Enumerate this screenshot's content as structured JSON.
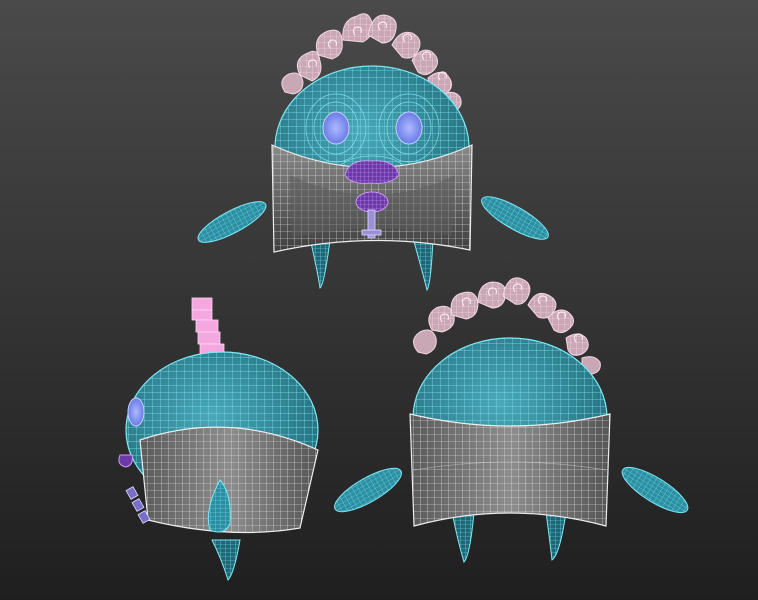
{
  "viewport": {
    "background_top": "#4a4a4a",
    "background_bottom": "#1f1f1f"
  },
  "colors": {
    "body_wire": "#5fd8e8",
    "body_fill": "#3b97a8",
    "collar_wire": "#e9e9e9",
    "collar_fill": "#6c6c6c",
    "petal_wire": "#f3d6e2",
    "petal_fill": "#c9a7b5",
    "mouth_wire": "#b27ce6",
    "mouth_fill": "#6b3aa8",
    "eye_fill": "#7b8cf0",
    "pink_blocks": "#f4a8df"
  },
  "models": [
    {
      "view": "front",
      "icon": "character-front-icon"
    },
    {
      "view": "side",
      "icon": "character-side-icon"
    },
    {
      "view": "back",
      "icon": "character-back-icon"
    }
  ]
}
